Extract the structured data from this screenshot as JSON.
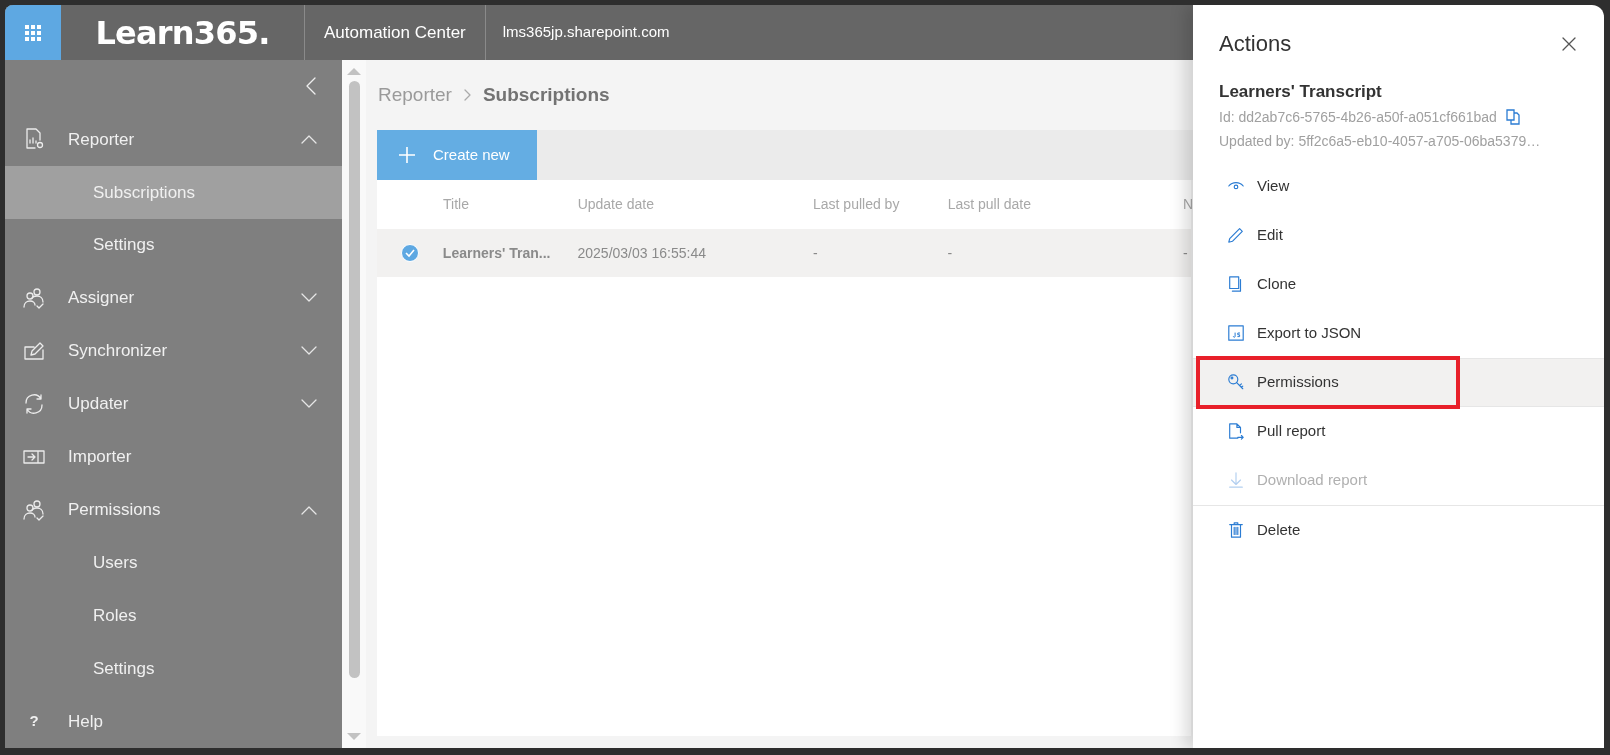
{
  "header": {
    "logo": "Learn365.",
    "app_name": "Automation Center",
    "site": "lms365jp.sharepoint.com"
  },
  "sidebar": {
    "items": [
      {
        "label": "Reporter",
        "expanded": true,
        "children": [
          {
            "label": "Subscriptions",
            "selected": true
          },
          {
            "label": "Settings",
            "selected": false
          }
        ]
      },
      {
        "label": "Assigner",
        "expanded": false
      },
      {
        "label": "Synchronizer",
        "expanded": false
      },
      {
        "label": "Updater",
        "expanded": false
      },
      {
        "label": "Importer"
      },
      {
        "label": "Permissions",
        "expanded": true,
        "children": [
          {
            "label": "Users",
            "selected": false
          },
          {
            "label": "Roles",
            "selected": false
          },
          {
            "label": "Settings",
            "selected": false
          }
        ]
      },
      {
        "label": "Help",
        "icon_text": "?"
      }
    ]
  },
  "breadcrumb": [
    "Reporter",
    "Subscriptions"
  ],
  "toolbar": {
    "create_button": "Create new"
  },
  "table": {
    "columns": [
      "Title",
      "Update date",
      "Last pulled by",
      "Last pull date",
      "N"
    ],
    "rows": [
      {
        "selected": true,
        "cells": [
          "Learners' Tran...",
          "2025/03/03 16:55:44",
          "-",
          "-",
          "-"
        ]
      }
    ]
  },
  "panel": {
    "title": "Actions",
    "item_title": "Learners' Transcript",
    "id": "Id: dd2ab7c6-5765-4b26-a50f-a051cf661bad",
    "updated_by": "Updated by: 5ff2c6a5-eb10-4057-a705-06ba5379…",
    "groups": [
      [
        {
          "label": "View",
          "disabled": false,
          "hovered": false,
          "annotated": false
        },
        {
          "label": "Edit",
          "disabled": false,
          "hovered": false,
          "annotated": false
        },
        {
          "label": "Clone",
          "disabled": false,
          "hovered": false,
          "annotated": false
        },
        {
          "label": "Export to JSON",
          "disabled": false,
          "hovered": false,
          "annotated": false
        },
        {
          "label": "Permissions",
          "disabled": false,
          "hovered": true,
          "annotated": true
        },
        {
          "label": "Pull report",
          "disabled": false,
          "hovered": false,
          "annotated": false
        },
        {
          "label": "Download report",
          "disabled": true,
          "hovered": false,
          "annotated": false
        }
      ],
      [
        {
          "label": "Delete",
          "disabled": false,
          "hovered": false,
          "annotated": false
        }
      ]
    ]
  }
}
